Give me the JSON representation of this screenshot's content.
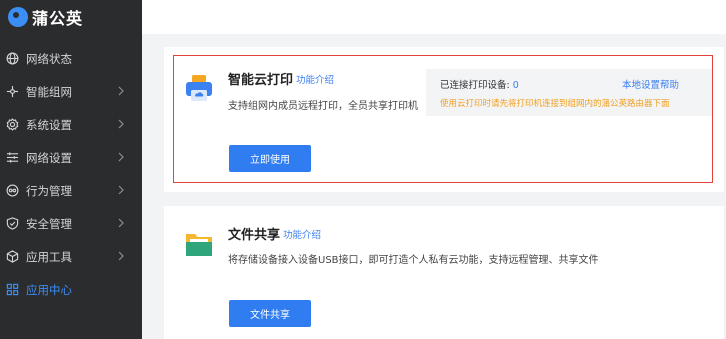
{
  "app": {
    "name": "蒲公英"
  },
  "sidebar": {
    "items": [
      {
        "label": "网络状态",
        "icon": "globe-icon",
        "has_chevron": false
      },
      {
        "label": "智能组网",
        "icon": "network-icon",
        "has_chevron": true
      },
      {
        "label": "系统设置",
        "icon": "gear-icon",
        "has_chevron": true
      },
      {
        "label": "网络设置",
        "icon": "sliders-icon",
        "has_chevron": true
      },
      {
        "label": "行为管理",
        "icon": "eye-icon",
        "has_chevron": true
      },
      {
        "label": "安全管理",
        "icon": "shield-icon",
        "has_chevron": true
      },
      {
        "label": "应用工具",
        "icon": "cube-icon",
        "has_chevron": true
      },
      {
        "label": "应用中心",
        "icon": "apps-icon",
        "has_chevron": false,
        "active": true
      }
    ]
  },
  "cloud_print": {
    "title": "智能云打印",
    "intro_link": "功能介绍",
    "description": "支持组网内成员远程打印，全员共享打印机",
    "button": "立即使用",
    "info": {
      "connected_label": "已连接打印设备:",
      "connected_count": "0",
      "help_link": "本地设置帮助",
      "warning": "使用云打印时请先将打印机连接到组网内的蒲公英路由器下面"
    }
  },
  "file_share": {
    "title": "文件共享",
    "intro_link": "功能介绍",
    "description": "将存储设备接入设备USB接口，即可打造个人私有云功能，支持远程管理、共享文件",
    "button": "文件共享"
  },
  "colors": {
    "accent": "#2f7df0",
    "sidebar_bg": "#2b2c2e",
    "warning": "#f0a020",
    "highlight_border": "#e0443b"
  }
}
